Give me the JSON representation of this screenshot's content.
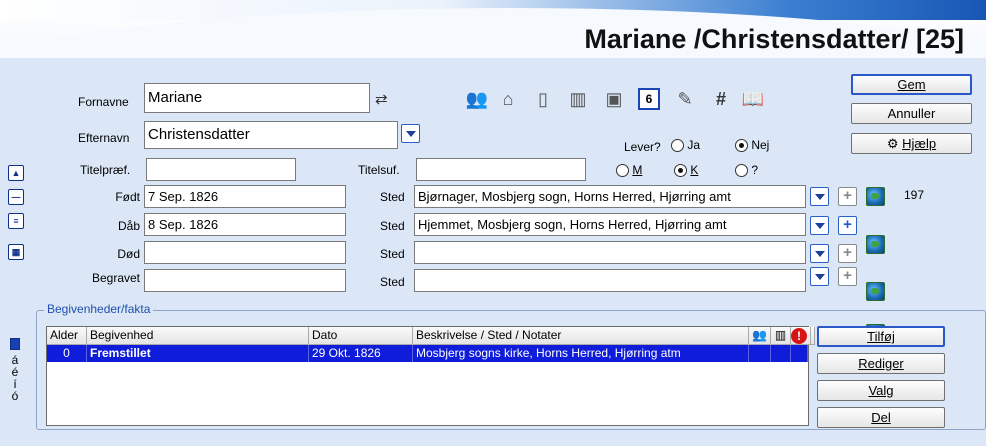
{
  "header": {
    "title": "Mariane /Christensdatter/ [25]"
  },
  "name": {
    "first_label": "Fornavne",
    "first_value": "Mariane",
    "last_label": "Efternavn",
    "last_value": "Christensdatter",
    "prefix_label": "Titelpræf.",
    "prefix_value": "",
    "suffix_label": "Titelsuf.",
    "suffix_value": ""
  },
  "status": {
    "alive_label": "Lever?",
    "alive_options": [
      "Ja",
      "Nej"
    ],
    "alive_selected": "Nej",
    "sex_options": [
      "M",
      "K",
      "?"
    ],
    "sex_selected": "K"
  },
  "events": {
    "place_label": "Sted",
    "birth": {
      "label": "Født",
      "date": "7 Sep. 1826",
      "place": "Bjørnager, Mosbjerg sogn, Horns Herred, Hjørring amt",
      "note": "197"
    },
    "baptism": {
      "label": "Dåb",
      "date": "8 Sep. 1826",
      "place": "Hjemmet, Mosbjerg sogn, Horns Herred, Hjørring amt"
    },
    "death": {
      "label": "Død",
      "date": "",
      "place": ""
    },
    "burial": {
      "label": "Begravet",
      "date": "",
      "place": ""
    }
  },
  "buttons": {
    "save": "Gem",
    "cancel": "Annuller",
    "help": "Hjælp"
  },
  "facts": {
    "group_title": "Begivenheder/fakta",
    "columns": [
      "Alder",
      "Begivenhed",
      "Dato",
      "Beskrivelse / Sted / Notater"
    ],
    "rows": [
      {
        "age": "0",
        "event": "Fremstillet",
        "date": "29 Okt. 1826",
        "desc": "Mosbjerg sogns kirke, Horns Herred, Hjørring atm"
      }
    ],
    "buttons": [
      "Tilføj",
      "Rediger",
      "Valg",
      "Del"
    ]
  },
  "sidebar": {
    "alpha_letters": [
      "á",
      "é",
      "í",
      "ó"
    ]
  },
  "icons": [
    "people-icon",
    "house-icon",
    "document-icon",
    "books-icon",
    "photo-icon",
    "calendar-icon",
    "notepad-icon",
    "hash-icon",
    "book-icon"
  ],
  "colors": {
    "selection": "#0f1ddb",
    "accent_blue": "#2456c9",
    "banner_blue": "#1856b4"
  }
}
